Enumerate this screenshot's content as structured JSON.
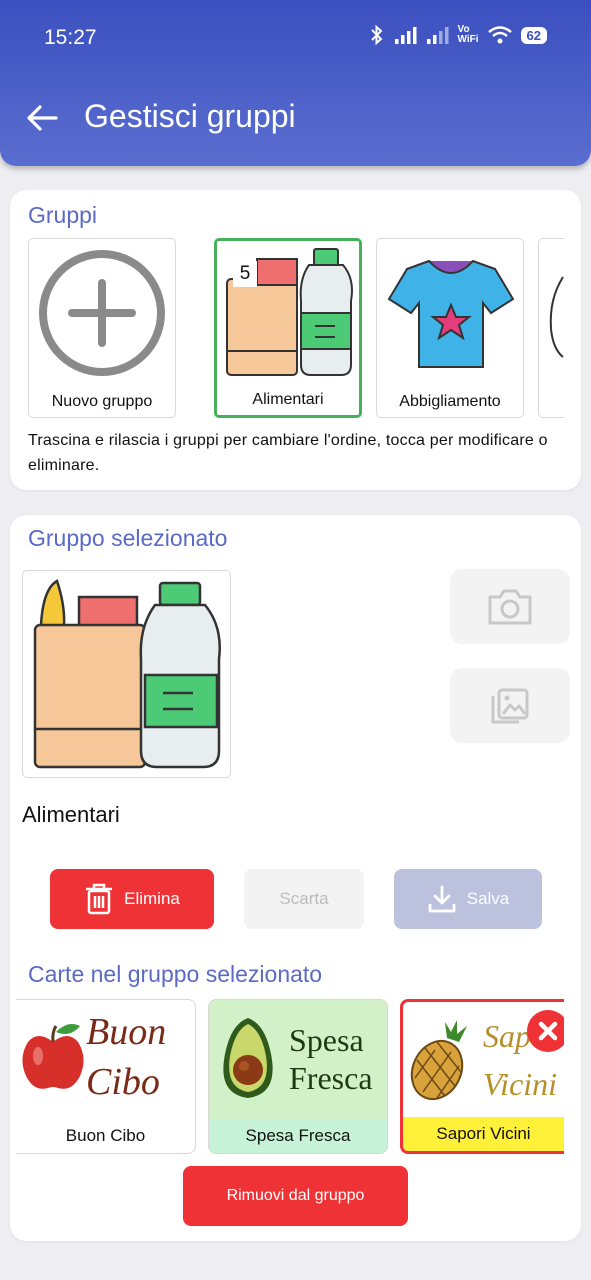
{
  "status": {
    "time": "15:27",
    "battery": "62",
    "vowifi_top": "Vo",
    "vowifi_bottom": "WiFi"
  },
  "header": {
    "title": "Gestisci gruppi"
  },
  "groups": {
    "title": "Gruppi",
    "items": [
      {
        "label": "Nuovo gruppo"
      },
      {
        "label": "Alimentari",
        "badge": "5",
        "selected": true
      },
      {
        "label": "Abbigliamento"
      }
    ],
    "hint": "Trascina e rilascia i gruppi per cambiare l'ordine, tocca per modificare o eliminare."
  },
  "selected_group": {
    "title": "Gruppo selezionato",
    "name": "Alimentari",
    "delete_label": "Elimina",
    "discard_label": "Scarta",
    "save_label": "Salva"
  },
  "cards": {
    "title": "Carte nel gruppo selezionato",
    "items": [
      {
        "label": "Buon Cibo",
        "image_line1": "Buon",
        "image_line2": "Cibo"
      },
      {
        "label": "Spesa Fresca",
        "image_line1": "Spesa",
        "image_line2": "Fresca"
      },
      {
        "label": "Sapori Vicini",
        "image_line1": "Sap",
        "image_line2": "Vicini"
      }
    ],
    "remove_label": "Rimuovi dal gruppo"
  },
  "colors": {
    "accent": "#5b6ac4",
    "danger": "#ef3236",
    "selected_border": "#46b05a"
  }
}
